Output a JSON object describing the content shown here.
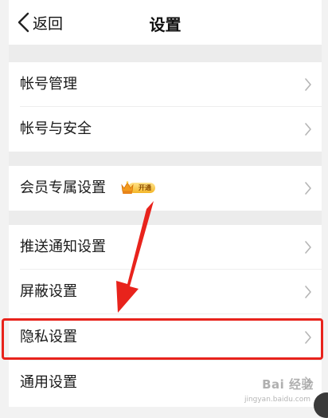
{
  "nav": {
    "back_label": "返回",
    "title": "设置"
  },
  "groups": [
    {
      "items": [
        {
          "label": "帐号管理"
        },
        {
          "label": "帐号与安全"
        }
      ]
    },
    {
      "items": [
        {
          "label": "会员专属设置",
          "badge": "开通"
        }
      ]
    },
    {
      "items": [
        {
          "label": "推送通知设置"
        },
        {
          "label": "屏蔽设置"
        },
        {
          "label": "隐私设置",
          "highlighted": true
        },
        {
          "label": "通用设置"
        }
      ]
    }
  ],
  "watermark": {
    "brand": "Bai 经验",
    "url": "jingyan.baidu.com"
  },
  "colors": {
    "highlight": "#e8231c",
    "badge_gold": "#f4b628"
  },
  "icons": [
    "chevron-left-icon",
    "chevron-right-icon",
    "crown-icon"
  ]
}
